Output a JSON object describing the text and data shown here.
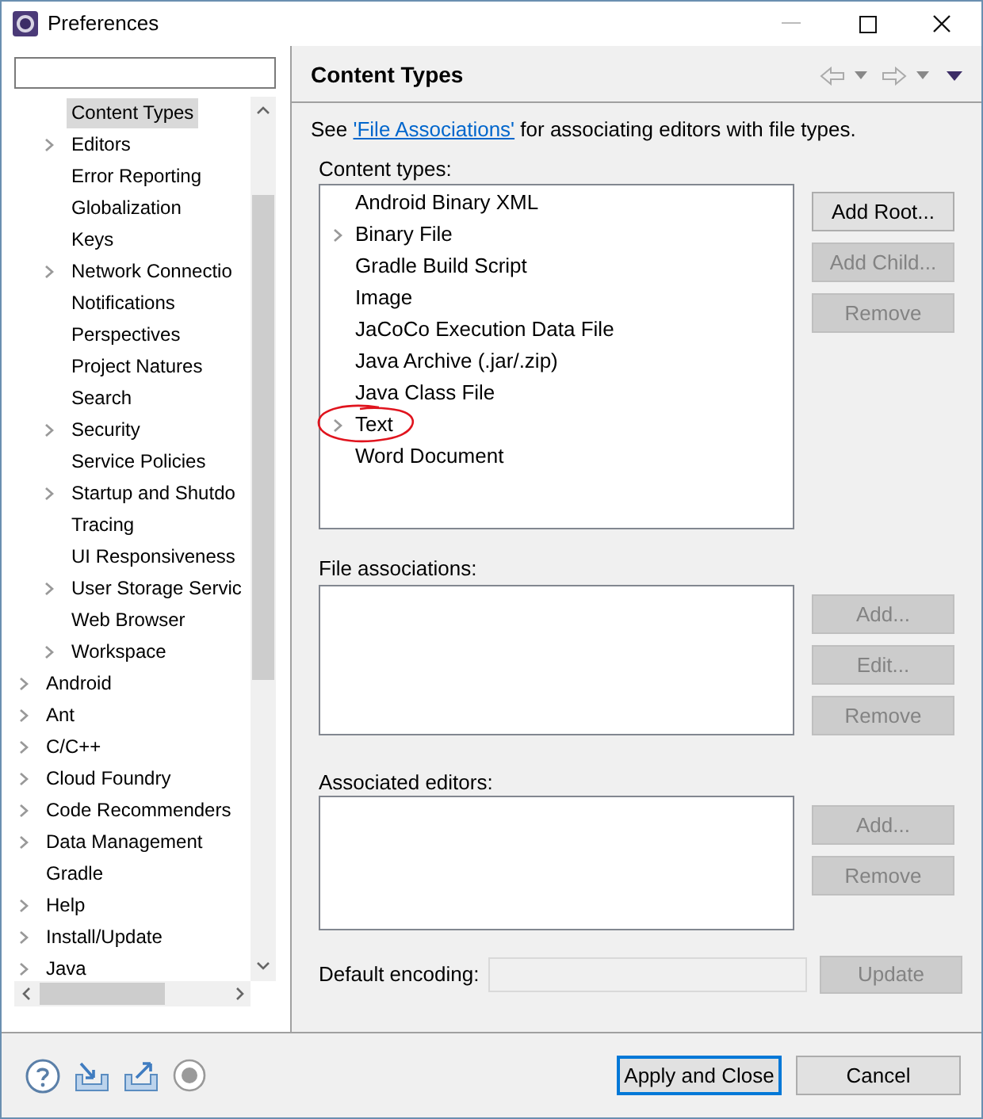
{
  "window": {
    "title": "Preferences"
  },
  "sidebar": {
    "items": [
      {
        "children": [
          {
            "label": "Content Types",
            "expandable": false,
            "selected": true
          },
          {
            "label": "Editors",
            "expandable": true,
            "selected": false
          },
          {
            "label": "Error Reporting",
            "expandable": false,
            "selected": false
          },
          {
            "label": "Globalization",
            "expandable": false,
            "selected": false
          },
          {
            "label": "Keys",
            "expandable": false,
            "selected": false
          },
          {
            "label": "Network Connectio",
            "expandable": true,
            "selected": false
          },
          {
            "label": "Notifications",
            "expandable": false,
            "selected": false
          },
          {
            "label": "Perspectives",
            "expandable": false,
            "selected": false
          },
          {
            "label": "Project Natures",
            "expandable": false,
            "selected": false
          },
          {
            "label": "Search",
            "expandable": false,
            "selected": false
          },
          {
            "label": "Security",
            "expandable": true,
            "selected": false
          },
          {
            "label": "Service Policies",
            "expandable": false,
            "selected": false
          },
          {
            "label": "Startup and Shutdo",
            "expandable": true,
            "selected": false
          },
          {
            "label": "Tracing",
            "expandable": false,
            "selected": false
          },
          {
            "label": "UI Responsiveness",
            "expandable": false,
            "selected": false
          },
          {
            "label": "User Storage Servic",
            "expandable": true,
            "selected": false
          },
          {
            "label": "Web Browser",
            "expandable": false,
            "selected": false
          },
          {
            "label": "Workspace",
            "expandable": true,
            "selected": false
          }
        ]
      },
      {
        "label": "Android",
        "expandable": true,
        "selected": false
      },
      {
        "label": "Ant",
        "expandable": true,
        "selected": false
      },
      {
        "label": "C/C++",
        "expandable": true,
        "selected": false
      },
      {
        "label": "Cloud Foundry",
        "expandable": true,
        "selected": false
      },
      {
        "label": "Code Recommenders",
        "expandable": true,
        "selected": false
      },
      {
        "label": "Data Management",
        "expandable": true,
        "selected": false
      },
      {
        "label": "Gradle",
        "expandable": false,
        "selected": false
      },
      {
        "label": "Help",
        "expandable": true,
        "selected": false
      },
      {
        "label": "Install/Update",
        "expandable": true,
        "selected": false
      },
      {
        "label": "Java",
        "expandable": true,
        "selected": false
      }
    ]
  },
  "page": {
    "title": "Content Types",
    "intro": {
      "before": "See ",
      "link": "'File Associations'",
      "after": " for associating editors with file types."
    },
    "content_types": {
      "label": "Content types:",
      "items": [
        {
          "label": "Android Binary XML",
          "expandable": false
        },
        {
          "label": "Binary File",
          "expandable": true
        },
        {
          "label": "Gradle Build Script",
          "expandable": false
        },
        {
          "label": "Image",
          "expandable": false
        },
        {
          "label": "JaCoCo Execution Data File",
          "expandable": false
        },
        {
          "label": "Java Archive (.jar/.zip)",
          "expandable": false
        },
        {
          "label": "Java Class File",
          "expandable": false
        },
        {
          "label": "Text",
          "expandable": true,
          "circled": true
        },
        {
          "label": "Word Document",
          "expandable": false
        }
      ],
      "buttons": [
        {
          "label": "Add Root...",
          "disabled": false
        },
        {
          "label": "Add Child...",
          "disabled": true
        },
        {
          "label": "Remove",
          "disabled": true
        }
      ]
    },
    "file_associations": {
      "label": "File associations:",
      "buttons": [
        {
          "label": "Add...",
          "disabled": true
        },
        {
          "label": "Edit...",
          "disabled": true
        },
        {
          "label": "Remove",
          "disabled": true
        }
      ]
    },
    "associated_editors": {
      "label": "Associated editors:",
      "buttons": [
        {
          "label": "Add...",
          "disabled": true
        },
        {
          "label": "Remove",
          "disabled": true
        }
      ]
    },
    "encoding": {
      "label": "Default encoding:",
      "button": {
        "label": "Update",
        "disabled": true
      }
    }
  },
  "footer": {
    "buttons": [
      {
        "label": "Apply and Close",
        "default": true
      },
      {
        "label": "Cancel",
        "default": false
      }
    ]
  }
}
